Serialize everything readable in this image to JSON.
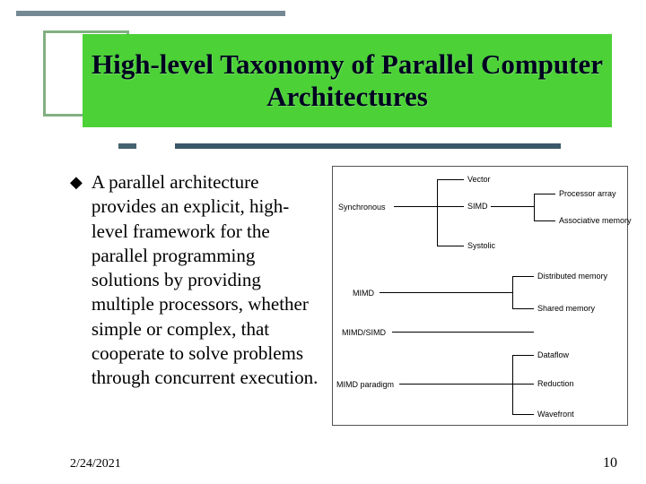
{
  "title": "High-level Taxonomy of Parallel Computer Architectures",
  "bullet": {
    "glyph": "◆",
    "text": "A parallel architecture provides an explicit, high-level framework for the parallel programming solutions by providing multiple processors, whether simple or complex, that cooperate to solve problems through concurrent execution."
  },
  "diagram": {
    "left": {
      "sync": "Synchronous",
      "mimd": "MIMD",
      "mimdsimd": "MIMD/SIMD",
      "paradigm": "MIMD paradigm"
    },
    "mid": {
      "vector": "Vector",
      "simd": "SIMD",
      "systolic": "Systolic",
      "dist": "Distributed memory",
      "shared": "Shared memory",
      "dataflow": "Dataflow",
      "reduction": "Reduction",
      "wavefront": "Wavefront"
    },
    "right": {
      "parray": "Processor array",
      "amem": "Associative memory"
    }
  },
  "footer": {
    "date": "2/24/2021",
    "page": "10"
  }
}
